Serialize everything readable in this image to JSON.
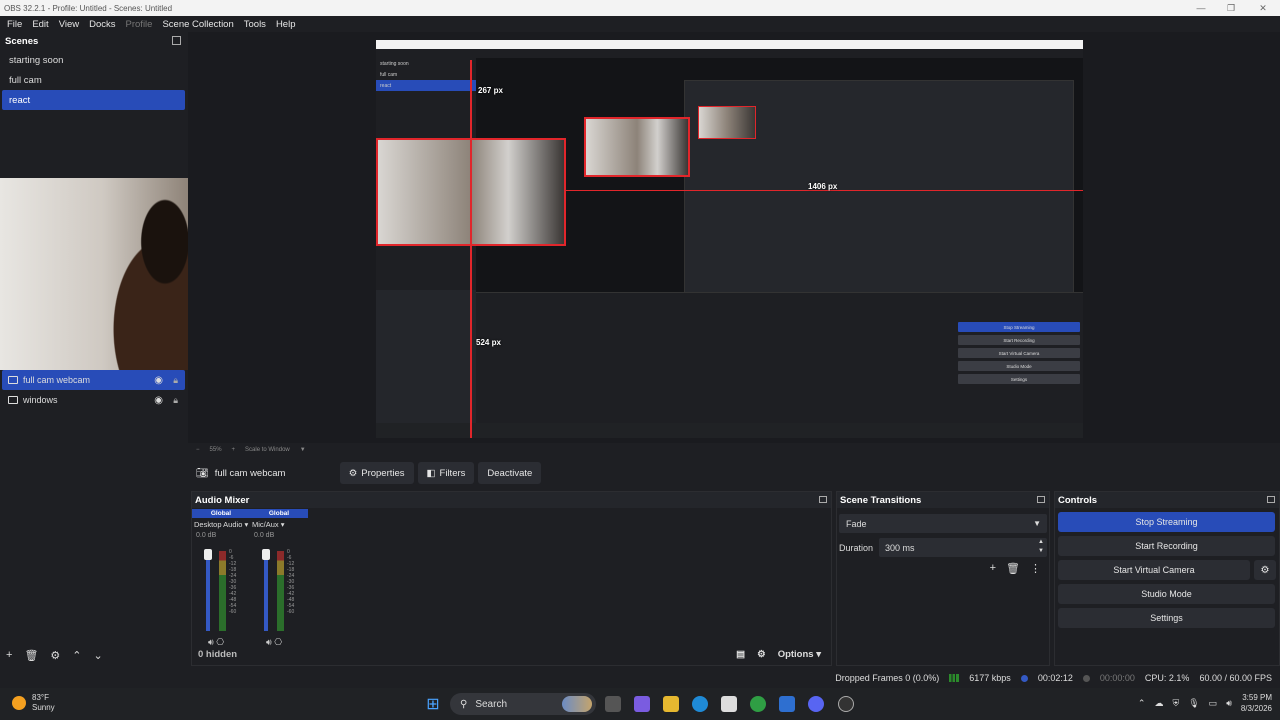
{
  "window": {
    "title": "OBS 32.2.1 - Profile: Untitled - Scenes: Untitled",
    "controls": [
      "—",
      "❐",
      "✕"
    ]
  },
  "menu": [
    "File",
    "Edit",
    "View",
    "Docks",
    "Profile",
    "Scene Collection",
    "Tools",
    "Help"
  ],
  "scenes": {
    "title": "Scenes",
    "items": [
      {
        "label": "starting soon"
      },
      {
        "label": "full cam"
      },
      {
        "label": "react"
      }
    ],
    "active_index": 2
  },
  "sources": {
    "items": [
      {
        "label": "full cam webcam",
        "icon": "camera-icon",
        "visible": true
      },
      {
        "label": "windows",
        "icon": "monitor-icon",
        "visible": true
      }
    ],
    "toolbar": [
      "+",
      "🗑",
      "⚙",
      "⌃",
      "⌄"
    ]
  },
  "preview": {
    "labels": {
      "width_label": "267 px",
      "height_label": "1406 px",
      "offset_label": "524 px"
    },
    "footer": {
      "zoom": "55%",
      "scale": "Scale to Window"
    }
  },
  "source_toolbar": {
    "source_name": "full cam webcam",
    "properties": "Properties",
    "filters": "Filters",
    "deactivate": "Deactivate"
  },
  "mixer": {
    "title": "Audio Mixer",
    "channels": [
      {
        "global": "Global",
        "name": "Desktop Audio",
        "db": "0.0 dB",
        "level": 0.25
      },
      {
        "global": "Global",
        "name": "Mic/Aux",
        "db": "0.0 dB",
        "level": 0.45
      }
    ],
    "scale": [
      "0",
      "-6",
      "-12",
      "-18",
      "-24",
      "-30",
      "-36",
      "-42",
      "-48",
      "-54",
      "-60"
    ],
    "hidden": "0 hidden",
    "options": "Options"
  },
  "transitions": {
    "title": "Scene Transitions",
    "selected": "Fade",
    "duration_label": "Duration",
    "duration_value": "300 ms"
  },
  "controls": {
    "title": "Controls",
    "stop_streaming": "Stop Streaming",
    "start_recording": "Start Recording",
    "start_virtual_camera": "Start Virtual Camera",
    "studio_mode": "Studio Mode",
    "settings": "Settings"
  },
  "status": {
    "dropped_frames": "Dropped Frames 0 (0.0%)",
    "bitrate": "6177 kbps",
    "stream_time": "00:02:12",
    "rec_time": "00:00:00",
    "cpu": "CPU: 2.1%",
    "fps": "60.00 / 60.00 FPS"
  },
  "taskbar": {
    "weather_temp": "83°F",
    "weather_desc": "Sunny",
    "search": "Search",
    "time": "3:59 PM",
    "date": "8/3/2026"
  },
  "colors": {
    "accent": "#284cb8",
    "guide": "#e1262b",
    "panel": "#1e1f23"
  }
}
